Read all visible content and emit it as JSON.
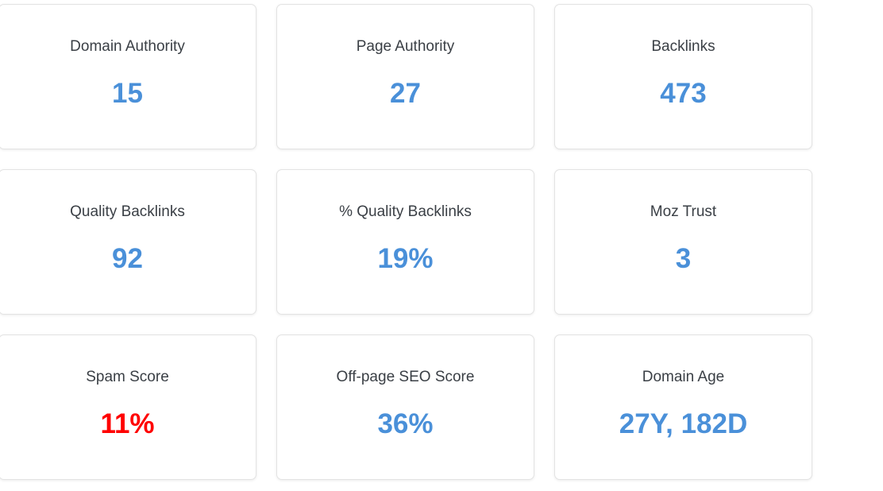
{
  "colors": {
    "value_default": "#4a90d9",
    "value_alert": "#ff0000",
    "label": "#3a3f45"
  },
  "metrics": [
    {
      "label": "Domain Authority",
      "value": "15",
      "status": "default"
    },
    {
      "label": "Page Authority",
      "value": "27",
      "status": "default"
    },
    {
      "label": "Backlinks",
      "value": "473",
      "status": "default"
    },
    {
      "label": "Quality Backlinks",
      "value": "92",
      "status": "default"
    },
    {
      "label": "% Quality Backlinks",
      "value": "19%",
      "status": "default"
    },
    {
      "label": "Moz Trust",
      "value": "3",
      "status": "default"
    },
    {
      "label": "Spam Score",
      "value": "11%",
      "status": "alert"
    },
    {
      "label": "Off-page SEO Score",
      "value": "36%",
      "status": "default"
    },
    {
      "label": "Domain Age",
      "value": "27Y, 182D",
      "status": "default"
    }
  ]
}
